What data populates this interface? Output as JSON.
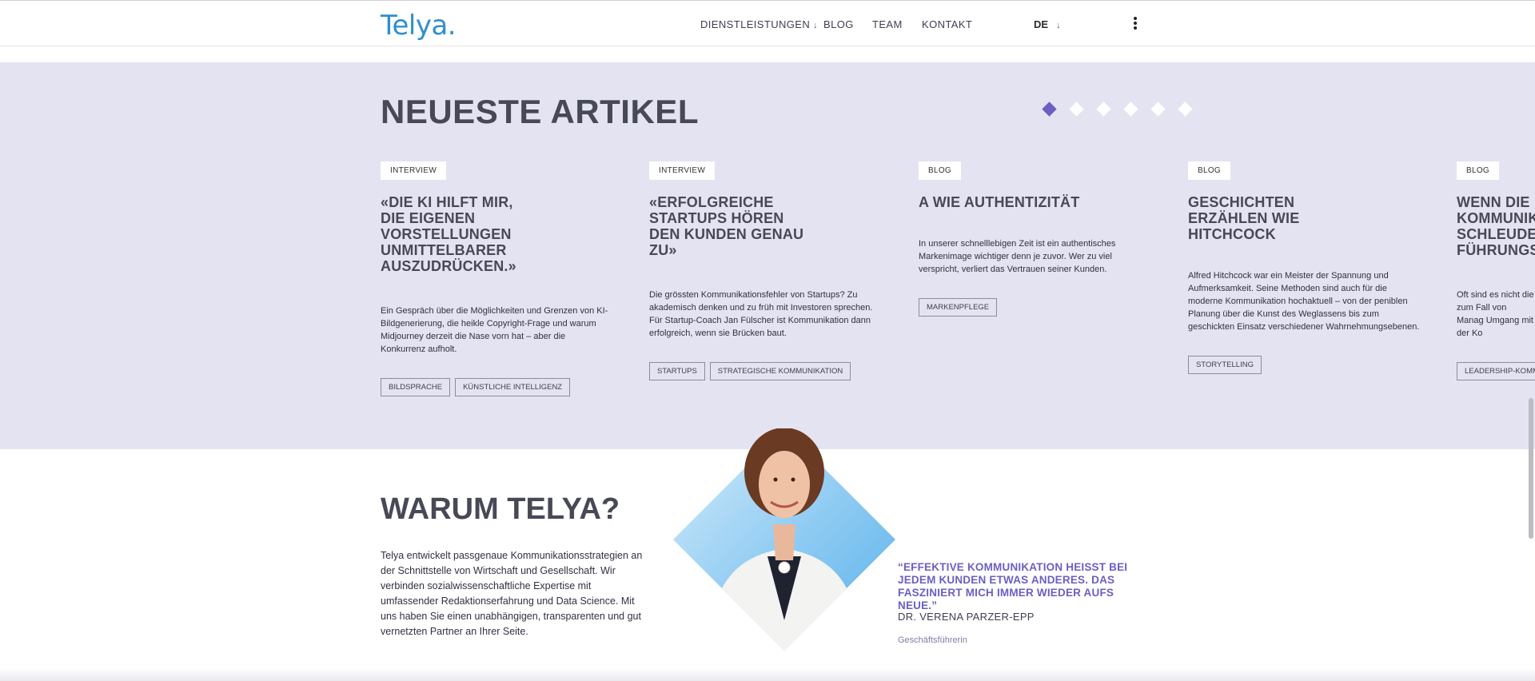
{
  "header": {
    "logo": "Telya.",
    "nav": {
      "services": "DIENSTLEISTUNGEN",
      "blog": "BLOG",
      "team": "TEAM",
      "kontakt": "KONTAKT"
    },
    "language": "DE"
  },
  "articles": {
    "section_title": "NEUESTE ARTIKEL",
    "carousel_pages": 6,
    "carousel_active": 1,
    "items": [
      {
        "category": "INTERVIEW",
        "title": "«DIE KI HILFT MIR, DIE EIGENEN VORSTELLUNGEN UNMITTELBARER AUSZUDRÜCKEN.»",
        "excerpt": "Ein Gespräch über die Möglichkeiten und Grenzen von KI-Bildgenerierung, die heikle Copyright-Frage und warum Midjourney derzeit die Nase vorn hat – aber die Konkurrenz aufholt.",
        "tags": [
          "BILDSPRACHE",
          "KÜNSTLICHE INTELLIGENZ"
        ]
      },
      {
        "category": "INTERVIEW",
        "title": "«ERFOLGREICHE STARTUPS HÖREN DEN KUNDEN GENAU ZU»",
        "excerpt": "Die grössten Kommunikationsfehler von Startups? Zu akademisch denken und zu früh mit Investoren sprechen. Für Startup-Coach Jan Fülscher ist Kommunikation dann erfolgreich, wenn sie Brücken baut.",
        "tags": [
          "STARTUPS",
          "STRATEGISCHE KOMMUNIKATION"
        ]
      },
      {
        "category": "BLOG",
        "title": "A WIE AUTHENTIZITÄT",
        "excerpt": "In unserer schnelllebigen Zeit ist ein authentisches Markenimage wichtiger denn je zuvor. Wer zu viel verspricht, verliert das Vertrauen seiner Kunden.",
        "tags": [
          "MARKENPFLEGE"
        ]
      },
      {
        "category": "BLOG",
        "title": "GESCHICHTEN ERZÄHLEN WIE HITCHCOCK",
        "excerpt": "Alfred Hitchcock war ein Meister der Spannung und Aufmerksamkeit. Seine Methoden sind auch für die moderne Kommunikation hochaktuell – von der peniblen Planung über die Kunst des Weglassens bis zum geschickten Einsatz verschiedener Wahrnehmungsebenen.",
        "tags": [
          "STORYTELLING"
        ]
      },
      {
        "category": "BLOG",
        "title": "WENN DIE KOMMUNIK SCHLEUDER FÜHRUNGS",
        "excerpt": "Oft sind es nicht die zum Fall von Manag Umgang mit der Ko",
        "tags": [
          "LEADERSHIP-KOMM"
        ]
      }
    ]
  },
  "why": {
    "title": "WARUM TELYA?",
    "text": "Telya entwickelt passgenaue Kommunikationsstrategien an der Schnittstelle von Wirtschaft und Gesellschaft. Wir verbinden sozialwissenschaftliche Expertise mit umfassender Redaktionserfahrung und Data Science. Mit uns haben Sie einen unabhängigen, transparenten und gut vernetzten Partner an Ihrer Seite.",
    "quote": "“EFFEKTIVE KOMMUNIKATION HEISST BEI JEDEM KUNDEN ETWAS ANDERES. DAS FASZINIERT MICH IMMER WIEDER AUFS NEUE.”",
    "person": "DR. VERENA PARZER-EPP",
    "role": "Geschäftsführerin"
  },
  "colors": {
    "accent": "#6b5fc2",
    "logo": "#2f8fcf",
    "section_bg": "#e4e3f1",
    "heading": "#474957"
  },
  "icons": {
    "dropdown": "arrow-down-icon",
    "menu": "kebab-menu-icon"
  }
}
